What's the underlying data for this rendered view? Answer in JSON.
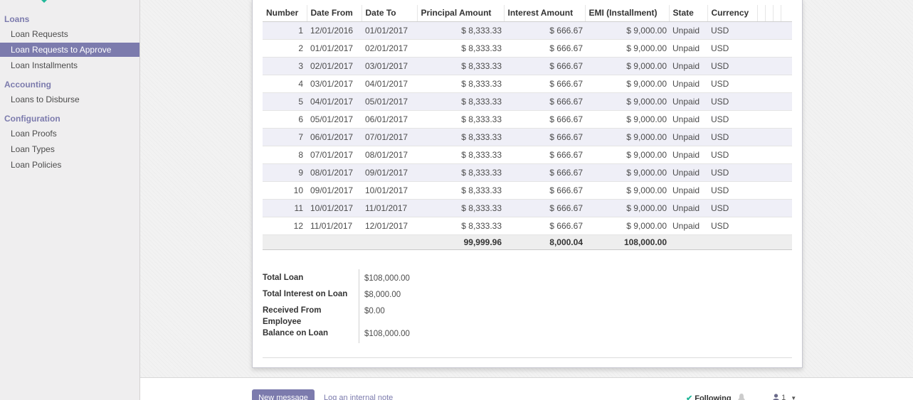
{
  "colors": {
    "brand": "#7c7bad",
    "logo_green": "#21b799",
    "row_stripe": "#efeff7",
    "footer_bg": "#eeeeee"
  },
  "sidebar": {
    "sections": [
      {
        "title": "Loans",
        "items": [
          {
            "label": "Loan Requests",
            "active": false
          },
          {
            "label": "Loan Requests to Approve",
            "active": true
          },
          {
            "label": "Loan Installments",
            "active": false
          }
        ]
      },
      {
        "title": "Accounting",
        "items": [
          {
            "label": "Loans to Disburse",
            "active": false
          }
        ]
      },
      {
        "title": "Configuration",
        "items": [
          {
            "label": "Loan Proofs",
            "active": false
          },
          {
            "label": "Loan Types",
            "active": false
          },
          {
            "label": "Loan Policies",
            "active": false
          }
        ]
      }
    ]
  },
  "installments": {
    "headers": [
      "Number",
      "Date From",
      "Date To",
      "Principal Amount",
      "Interest Amount",
      "EMI (Installment)",
      "State",
      "Currency"
    ],
    "rows": [
      {
        "number": "1",
        "date_from": "12/01/2016",
        "date_to": "01/01/2017",
        "principal": "$ 8,333.33",
        "interest": "$ 666.67",
        "emi": "$ 9,000.00",
        "state": "Unpaid",
        "currency": "USD"
      },
      {
        "number": "2",
        "date_from": "01/01/2017",
        "date_to": "02/01/2017",
        "principal": "$ 8,333.33",
        "interest": "$ 666.67",
        "emi": "$ 9,000.00",
        "state": "Unpaid",
        "currency": "USD"
      },
      {
        "number": "3",
        "date_from": "02/01/2017",
        "date_to": "03/01/2017",
        "principal": "$ 8,333.33",
        "interest": "$ 666.67",
        "emi": "$ 9,000.00",
        "state": "Unpaid",
        "currency": "USD"
      },
      {
        "number": "4",
        "date_from": "03/01/2017",
        "date_to": "04/01/2017",
        "principal": "$ 8,333.33",
        "interest": "$ 666.67",
        "emi": "$ 9,000.00",
        "state": "Unpaid",
        "currency": "USD"
      },
      {
        "number": "5",
        "date_from": "04/01/2017",
        "date_to": "05/01/2017",
        "principal": "$ 8,333.33",
        "interest": "$ 666.67",
        "emi": "$ 9,000.00",
        "state": "Unpaid",
        "currency": "USD"
      },
      {
        "number": "6",
        "date_from": "05/01/2017",
        "date_to": "06/01/2017",
        "principal": "$ 8,333.33",
        "interest": "$ 666.67",
        "emi": "$ 9,000.00",
        "state": "Unpaid",
        "currency": "USD"
      },
      {
        "number": "7",
        "date_from": "06/01/2017",
        "date_to": "07/01/2017",
        "principal": "$ 8,333.33",
        "interest": "$ 666.67",
        "emi": "$ 9,000.00",
        "state": "Unpaid",
        "currency": "USD"
      },
      {
        "number": "8",
        "date_from": "07/01/2017",
        "date_to": "08/01/2017",
        "principal": "$ 8,333.33",
        "interest": "$ 666.67",
        "emi": "$ 9,000.00",
        "state": "Unpaid",
        "currency": "USD"
      },
      {
        "number": "9",
        "date_from": "08/01/2017",
        "date_to": "09/01/2017",
        "principal": "$ 8,333.33",
        "interest": "$ 666.67",
        "emi": "$ 9,000.00",
        "state": "Unpaid",
        "currency": "USD"
      },
      {
        "number": "10",
        "date_from": "09/01/2017",
        "date_to": "10/01/2017",
        "principal": "$ 8,333.33",
        "interest": "$ 666.67",
        "emi": "$ 9,000.00",
        "state": "Unpaid",
        "currency": "USD"
      },
      {
        "number": "11",
        "date_from": "10/01/2017",
        "date_to": "11/01/2017",
        "principal": "$ 8,333.33",
        "interest": "$ 666.67",
        "emi": "$ 9,000.00",
        "state": "Unpaid",
        "currency": "USD"
      },
      {
        "number": "12",
        "date_from": "11/01/2017",
        "date_to": "12/01/2017",
        "principal": "$ 8,333.33",
        "interest": "$ 666.67",
        "emi": "$ 9,000.00",
        "state": "Unpaid",
        "currency": "USD"
      }
    ],
    "totals": {
      "principal": "99,999.96",
      "interest": "8,000.04",
      "emi": "108,000.00"
    }
  },
  "summary": {
    "total_loan": {
      "label": "Total Loan",
      "value": "$108,000.00"
    },
    "total_interest": {
      "label": "Total Interest on Loan",
      "value": "$8,000.00"
    },
    "received": {
      "label": "Received From Employee",
      "value": "$0.00"
    },
    "balance": {
      "label": "Balance on Loan",
      "value": "$108,000.00"
    }
  },
  "chatter": {
    "new_message": "New message",
    "log_note": "Log an internal note",
    "following": "Following",
    "followers_count": "1"
  }
}
